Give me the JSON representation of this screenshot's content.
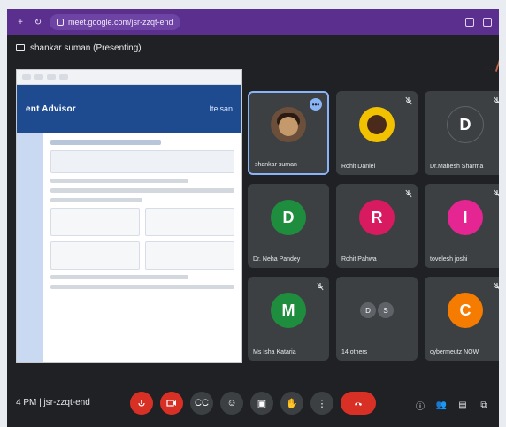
{
  "browser": {
    "url": "meet.google.com/jsr-zzqt-end"
  },
  "meeting": {
    "presenting_label": "shankar suman (Presenting)",
    "time": "4 PM",
    "meeting_code": "jsr-zzqt-end"
  },
  "shared_screen": {
    "brand": "ent Advisor",
    "logo_text": "Itelsan"
  },
  "participants": [
    {
      "name": "shankar suman",
      "type": "photo",
      "active": true
    },
    {
      "name": "Rohit Daniel",
      "type": "yellow"
    },
    {
      "name": "Dr.Mahesh Sharma",
      "initial": "D",
      "color": "#3c4043"
    },
    {
      "name": "Dr. Neha Pandey",
      "initial": "D",
      "color": "#1e8e3e"
    },
    {
      "name": "Rohit Pahwa",
      "initial": "R",
      "color": "#d81b60"
    },
    {
      "name": "tovelesh joshi",
      "initial": "I",
      "color": "#e52592"
    },
    {
      "name": "Ms Isha Kataria",
      "initial": "M",
      "color": "#1e8e3e"
    },
    {
      "name": "14 others",
      "type": "multi",
      "initials": [
        "D",
        "S"
      ]
    },
    {
      "name": "cybermeutz NOW",
      "initial": "C",
      "color": "#f57c00"
    }
  ]
}
